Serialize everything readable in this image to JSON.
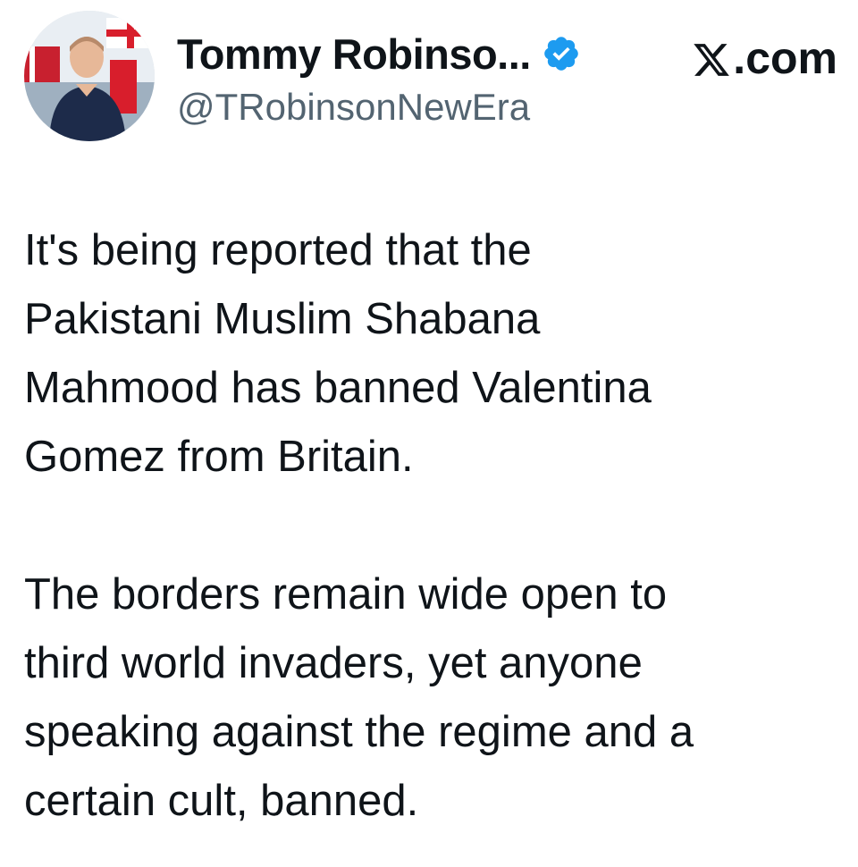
{
  "author": {
    "display_name": "Tommy Robinso...",
    "handle": "@TRobinsonNewEra",
    "verified": true,
    "avatar_icon": "profile-photo"
  },
  "brand": {
    "label": ".com",
    "logo_icon": "x-logo-icon"
  },
  "tweet": {
    "paragraphs": [
      "It's being reported that the\nPakistani Muslim Shabana\nMahmood has banned Valentina\nGomez from Britain.",
      "The borders remain wide open to\nthird world invaders, yet anyone\nspeaking against the regime and a\ncertain cult, banned."
    ]
  },
  "colors": {
    "text": "#0f1419",
    "secondary_text": "#536471",
    "verified_badge": "#1d9bf0",
    "background": "#ffffff"
  }
}
